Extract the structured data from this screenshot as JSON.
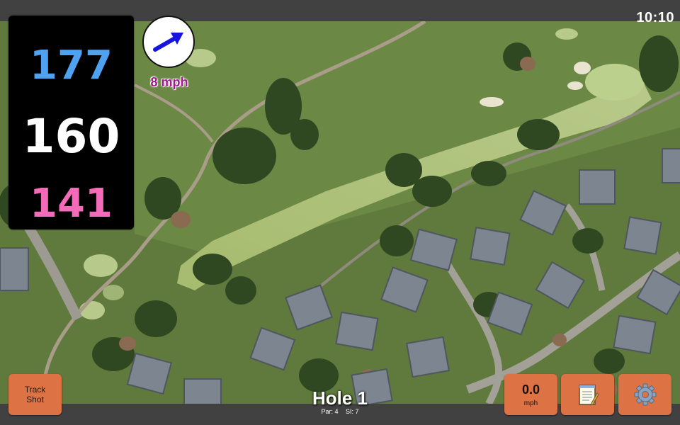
{
  "status": {
    "time": "10:10"
  },
  "distances": {
    "back": "177",
    "middle": "160",
    "front": "141"
  },
  "wind": {
    "speed": "8 mph",
    "icon": "wind-arrow-icon"
  },
  "buttons": {
    "track_line1": "Track",
    "track_line2": "Shot",
    "speed_value": "0.0",
    "speed_unit": "mph",
    "notes_icon": "notepad-icon",
    "settings_icon": "gear-icon"
  },
  "hole": {
    "title": "Hole 1",
    "par": "Par: 4",
    "si": "SI: 7"
  },
  "colors": {
    "back_distance": "#4ea2f0",
    "middle_distance": "#ffffff",
    "front_distance": "#f46bba",
    "button_bg": "#dd7345",
    "wind_text": "#a11a8e"
  }
}
